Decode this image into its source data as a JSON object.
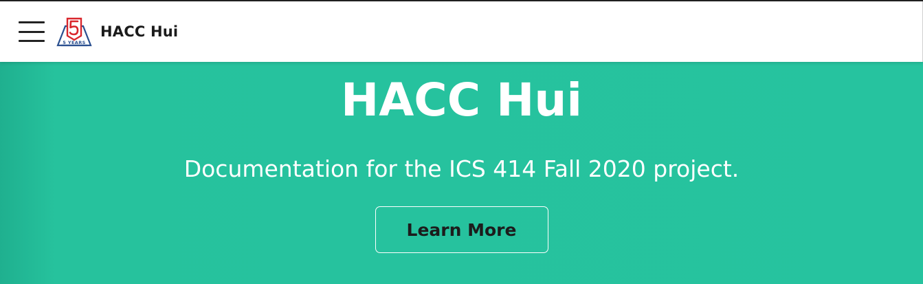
{
  "navbar": {
    "brand_title": "HACC Hui",
    "menu_icon": "hamburger-menu-icon",
    "logo_icon": "hacc-5-years-logo",
    "logo_text": "5 YEARS"
  },
  "hero": {
    "title": "HACC Hui",
    "subtitle": "Documentation for the ICS 414 Fall 2020 project.",
    "button_label": "Learn More"
  },
  "colors": {
    "hero_background": "#26c39f",
    "logo_red": "#d9262c",
    "logo_blue": "#2a4f8f",
    "text_dark": "#1b1b1b"
  }
}
